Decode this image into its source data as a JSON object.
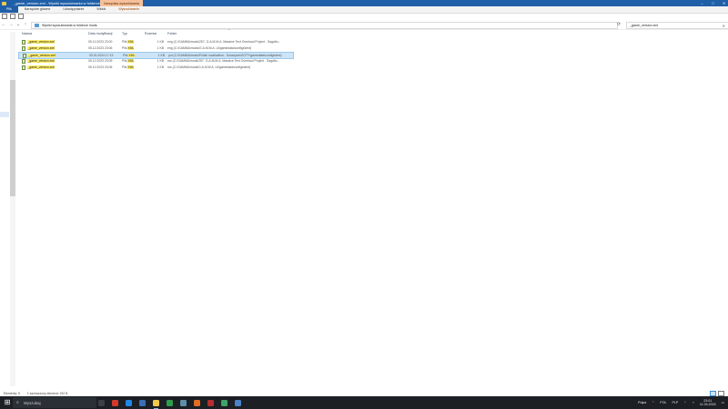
{
  "window": {
    "title": "_game_version.xml - Wyniki wyszukiwania w folderze mods",
    "context_tab": "Narzędzia wyszukiwania"
  },
  "ribbon": {
    "tabs": [
      "Plik",
      "Narzędzie główne",
      "Udostępnianie",
      "Widok",
      "Wyszukiwanie"
    ]
  },
  "address": {
    "path": "Wyniki wyszukiwania w folderze mods",
    "search_value": "_game_version.xml"
  },
  "columns": {
    "name": "Nazwa",
    "date": "Data modyfikacji",
    "type": "Typ",
    "size": "Rozmiar",
    "folder": "Folder"
  },
  "rows": [
    {
      "name": "_game_version.xml",
      "date": "05.12.2023 23:00",
      "type_prefix": "Plik ",
      "type_hl": "XML",
      "size": "1 KB",
      "folder": "eng (C:\\GAMMA\\mods\\257- G.A.M.M.A. Massive Text Overhaul Project - Sagafio...",
      "selected": false
    },
    {
      "name": "_game_version.xml",
      "date": "05.12.2023 23:06",
      "type_prefix": "Plik ",
      "type_hl": "XML",
      "size": "1 KB",
      "folder": "eng (C:\\GAMMA\\mods\\G.A.M.M.A. UI\\gamedata\\configs\\text)",
      "selected": false
    },
    {
      "name": "_game_version.xml",
      "date": "03.01.2024 17:13",
      "type_prefix": "Plik ",
      "type_hl": "XML",
      "size": "1 KB",
      "folder": "pol (C:\\GAMMA\\mods\\Polish localization - Szczepan\\GOTY\\gamedata\\configs\\text)",
      "selected": true
    },
    {
      "name": "_game_version.xml",
      "date": "05.12.2023 23:09",
      "type_prefix": "Plik ",
      "type_hl": "XML",
      "size": "1 KB",
      "folder": "rus (C:\\GAMMA\\mods\\257- G.A.M.M.A. Massive Text Overhaul Project - Sagafio...",
      "selected": false
    },
    {
      "name": "_game_version.xml",
      "date": "05.12.2023 23:06",
      "type_prefix": "Plik ",
      "type_hl": "XML",
      "size": "1 KB",
      "folder": "rus (C:\\GAMMA\\mods\\G.A.M.M.A. UI\\gamedata\\configs\\text)",
      "selected": false
    }
  ],
  "status": {
    "count": "Elementy: 5",
    "selected": "1 zaznaczony element: 192 B"
  },
  "taskbar": {
    "search_placeholder": "Wyszukaj",
    "tray_lang": "POL",
    "tray_kbd": "PLP",
    "weather": "Pułpa",
    "time": "23:01",
    "date": "11.04.2024"
  },
  "colors": {
    "titlebar": "#1f5fa8",
    "context_tab": "#f6c19a",
    "highlight": "#ffef6b",
    "selection": "#cce4f7",
    "taskbar": "#1c1f24"
  }
}
